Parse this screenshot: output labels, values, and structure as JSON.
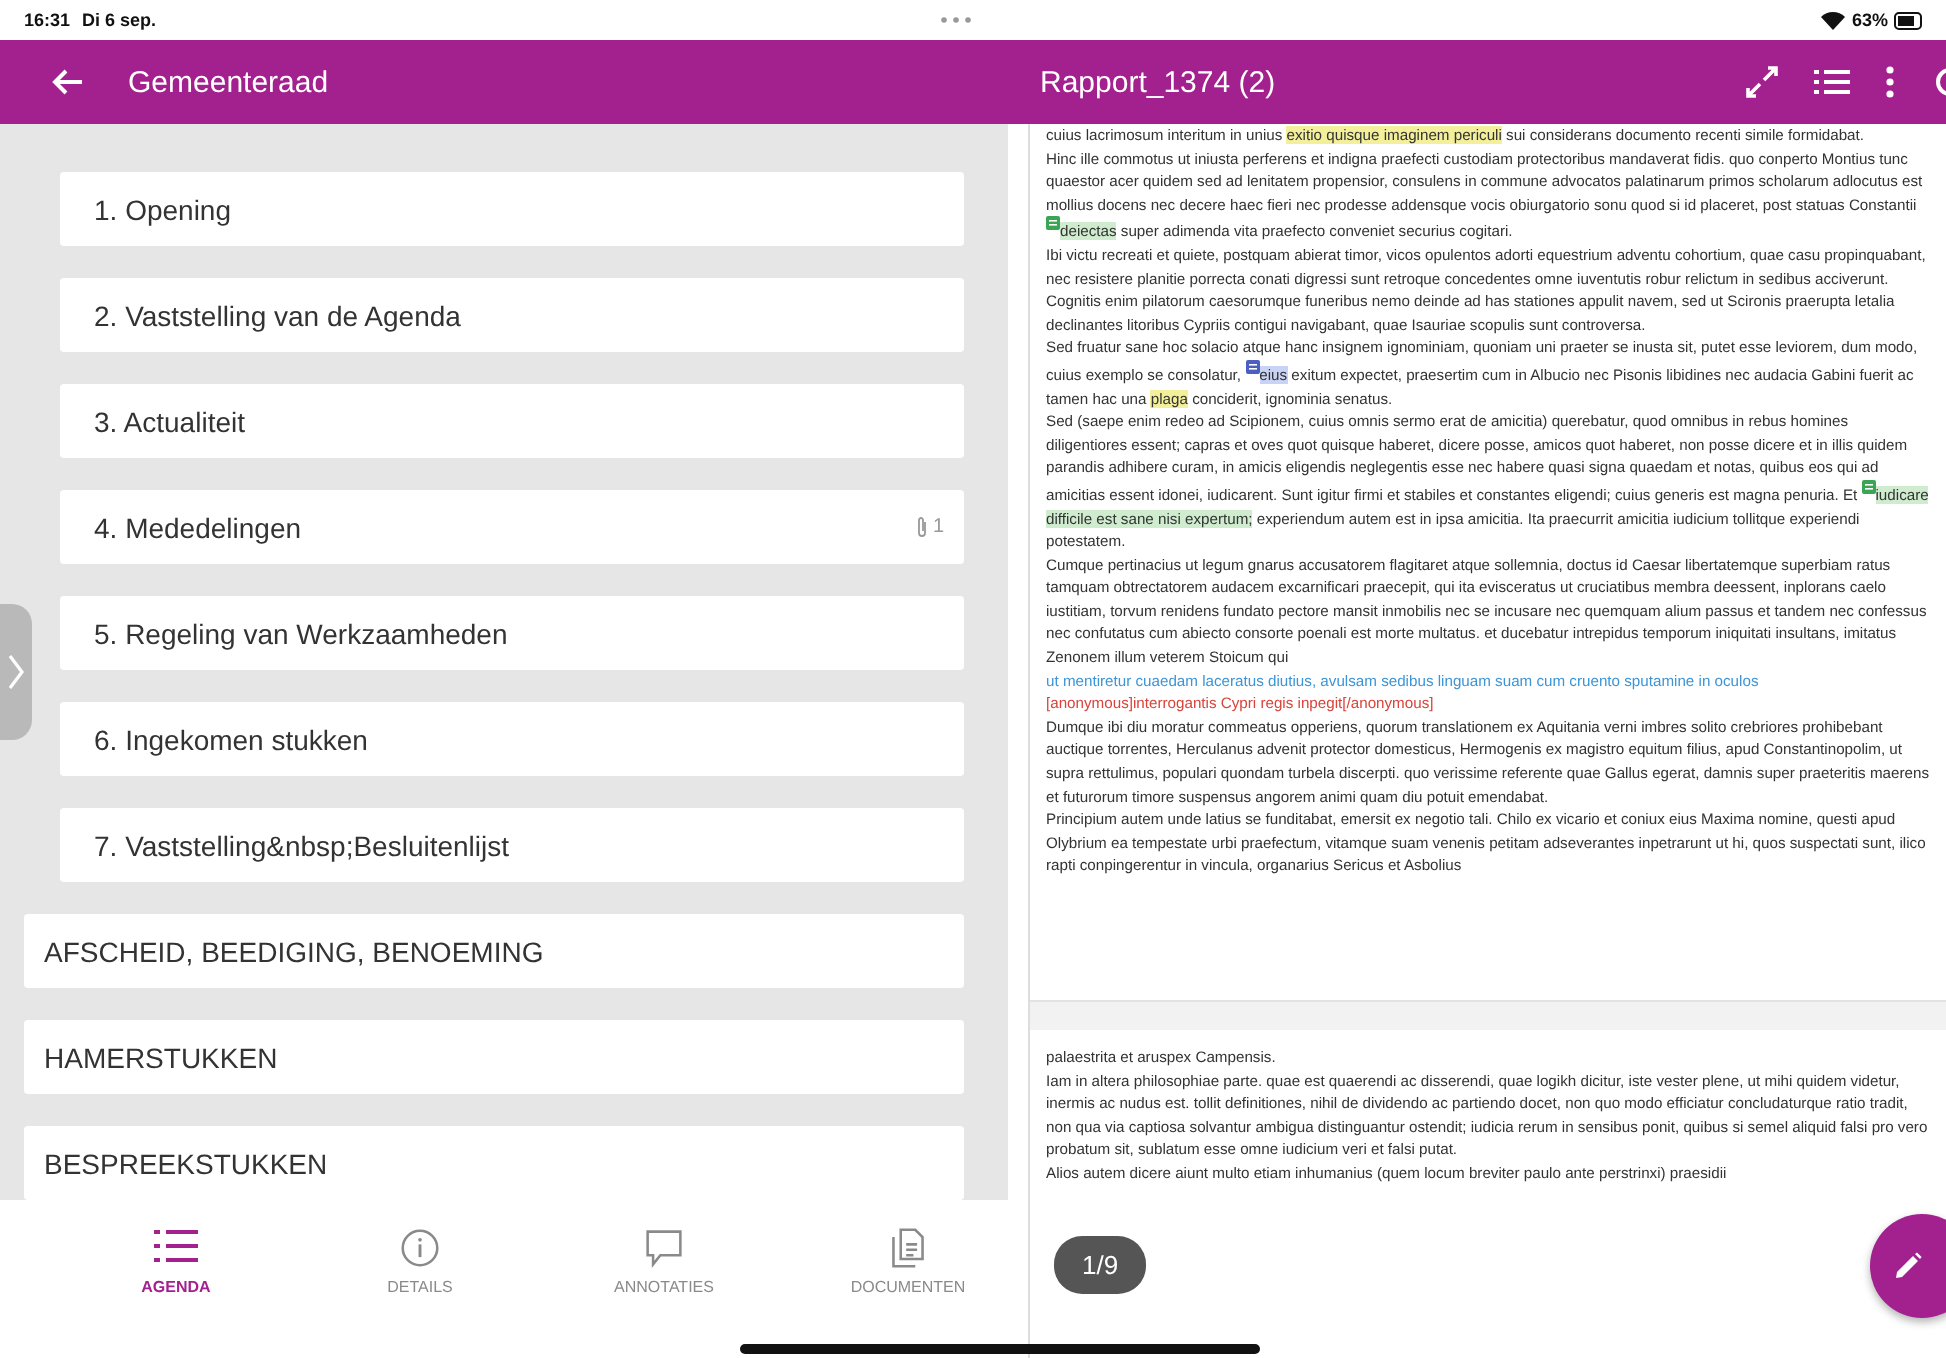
{
  "status_bar": {
    "time": "16:31",
    "date": "Di 6 sep.",
    "battery": "63%"
  },
  "header": {
    "back_title": "Gemeenteraad",
    "document_title": "Rapport_1374 (2)"
  },
  "agenda": {
    "items": [
      {
        "label": "1. Opening",
        "kind": "item"
      },
      {
        "label": "2. Vaststelling van de Agenda",
        "kind": "item"
      },
      {
        "label": "3. Actualiteit",
        "kind": "item"
      },
      {
        "label": "4. Mededelingen",
        "kind": "item",
        "attachments": "1"
      },
      {
        "label": "5. Regeling van Werkzaamheden",
        "kind": "item"
      },
      {
        "label": "6. Ingekomen stukken",
        "kind": "item"
      },
      {
        "label": "7. Vaststelling&nbsp;Besluitenlijst",
        "kind": "item"
      },
      {
        "label": "AFSCHEID, BEEDIGING, BENOEMING",
        "kind": "section"
      },
      {
        "label": "HAMERSTUKKEN",
        "kind": "section"
      },
      {
        "label": "BESPREEKSTUKKEN",
        "kind": "section"
      }
    ]
  },
  "bottom_tabs": [
    {
      "label": "AGENDA",
      "selected": true
    },
    {
      "label": "DETAILS",
      "selected": false
    },
    {
      "label": "ANNOTATIES",
      "selected": false
    },
    {
      "label": "DOCUMENTEN",
      "selected": false
    }
  ],
  "document": {
    "page_indicator": "1/9",
    "pages": [
      {
        "paragraphs": [
          {
            "segments": [
              {
                "kind": "plain",
                "text": "cuius lacrimosum interitum in unius "
              },
              {
                "kind": "highlight",
                "color": "#f3ef9a",
                "text": "exitio quisque imaginem periculi"
              },
              {
                "kind": "plain",
                "text": " sui considerans documento recenti simile formidabat."
              }
            ]
          },
          {
            "segments": [
              {
                "kind": "plain",
                "text": "Hinc ille commotus ut iniusta perferens et indigna praefecti custodiam protectoribus mandaverat fidis. quo conperto Montius tunc quaestor acer quidem sed ad lenitatem propensior, consulens in commune advocatos palatinarum primos scholarum adlocutus est mollius docens nec decere haec fieri nec prodesse addensque vocis obiurgatorio sonu quod si id placeret, post statuas Constantii "
              },
              {
                "kind": "note",
                "color": "#3aa655"
              },
              {
                "kind": "highlight",
                "color": "#cfeccf",
                "text": "deiectas"
              },
              {
                "kind": "plain",
                "text": " super adimenda vita praefecto conveniet securius cogitari."
              }
            ]
          },
          {
            "segments": [
              {
                "kind": "plain",
                "text": "Ibi victu recreati et quiete, postquam abierat timor, vicos opulentos adorti equestrium adventu cohortium, quae casu propinquabant, nec resistere planitie porrecta conati digressi sunt retroque concedentes omne iuventutis robur relictum in sedibus acciverunt."
              }
            ]
          },
          {
            "segments": [
              {
                "kind": "plain",
                "text": "Cognitis enim pilatorum caesorumque funeribus nemo deinde ad has stationes appulit navem, sed ut Scironis praerupta letalia declinantes litoribus Cypriis contigui navigabant, quae Isauriae scopulis sunt controversa."
              }
            ]
          },
          {
            "segments": [
              {
                "kind": "plain",
                "text": "Sed fruatur sane hoc solacio atque hanc insignem ignominiam, quoniam uni praeter se inusta sit, putet esse leviorem, dum modo, cuius exemplo se consolatur, "
              },
              {
                "kind": "note",
                "color": "#4a5fc1"
              },
              {
                "kind": "highlight",
                "color": "#c9d3f5",
                "text": "eius"
              },
              {
                "kind": "plain",
                "text": " exitum expectet, praesertim cum in Albucio nec Pisonis libidines nec audacia Gabini fuerit ac tamen hac una "
              },
              {
                "kind": "highlight",
                "color": "#f3ef9a",
                "text": "plaga"
              },
              {
                "kind": "plain",
                "text": " conciderit, ignominia senatus."
              }
            ]
          },
          {
            "segments": [
              {
                "kind": "plain",
                "text": "Sed (saepe enim redeo ad Scipionem, cuius omnis sermo erat de amicitia) querebatur, quod omnibus in rebus homines diligentiores essent; capras et oves quot quisque haberet, dicere posse, amicos quot haberet, non posse dicere et in illis quidem parandis adhibere curam, in amicis eligendis neglegentis esse nec habere quasi signa quaedam et notas, quibus eos qui ad amicitias essent idonei, iudicarent. Sunt igitur firmi et stabiles et constantes eligendi; cuius generis est magna penuria. Et "
              },
              {
                "kind": "note",
                "color": "#3aa655"
              },
              {
                "kind": "highlight",
                "color": "#cfeccf",
                "text": "iudicare difficile est sane nisi expertum;"
              },
              {
                "kind": "plain",
                "text": " experiendum autem est in ipsa amicitia. Ita praecurrit amicitia iudicium tollitque experiendi potestatem."
              }
            ]
          },
          {
            "segments": [
              {
                "kind": "plain",
                "text": "Cumque pertinacius ut legum gnarus accusatorem flagitaret atque sollemnia, doctus id Caesar libertatemque superbiam ratus tamquam obtrectatorem audacem excarnificari praecepit, qui ita evisceratus ut cruciatibus membra deessent, inplorans caelo iustitiam, torvum renidens fundato pectore mansit inmobilis nec se incusare nec quemquam alium passus et tandem nec confessus nec confutatus cum abiecto consorte poenali est morte multatus. et ducebatur intrepidus temporum iniquitati insultans, imitatus Zenonem illum veterem Stoicum qui"
              }
            ]
          },
          {
            "segments": [
              {
                "kind": "colored",
                "color": "#3d95d6",
                "text": "ut mentiretur cuaedam laceratus diutius, avulsam sedibus linguam suam cum cruento sputamine in oculos"
              }
            ]
          },
          {
            "segments": [
              {
                "kind": "colored",
                "color": "#d9433a",
                "text": "[anonymous]interrogantis Cypri regis inpegit[/anonymous]"
              }
            ]
          },
          {
            "segments": [
              {
                "kind": "plain",
                "text": "Dumque ibi diu moratur commeatus opperiens, quorum translationem ex Aquitania verni imbres solito crebriores prohibebant auctique torrentes, Herculanus advenit protector domesticus, Hermogenis ex magistro equitum filius, apud Constantinopolim, ut supra rettulimus, populari quondam turbela discerpti. quo verissime referente quae Gallus egerat, damnis super praeteritis maerens et futurorum timore suspensus angorem animi quam diu potuit emendabat."
              }
            ]
          },
          {
            "segments": [
              {
                "kind": "plain",
                "text": "Principium autem unde latius se funditabat, emersit ex negotio tali. Chilo ex vicario et coniux eius Maxima nomine, questi apud Olybrium ea tempestate urbi praefectum, vitamque suam venenis petitam adseverantes inpetrarunt ut hi, quos suspectati sunt, ilico rapti conpingerentur in vincula, organarius Sericus et Asbolius"
              }
            ]
          }
        ]
      },
      {
        "paragraphs": [
          {
            "segments": [
              {
                "kind": "plain",
                "text": "palaestrita et aruspex Campensis."
              }
            ]
          },
          {
            "segments": [
              {
                "kind": "plain",
                "text": "Iam in altera philosophiae parte. quae est quaerendi ac disserendi, quae logikh dicitur, iste vester plene, ut mihi quidem videtur, inermis ac nudus est. tollit definitiones, nihil de dividendo ac partiendo docet, non quo modo efficiatur concludaturque ratio tradit, non qua via captiosa solvantur ambigua distinguantur ostendit; iudicia rerum in sensibus ponit, quibus si semel aliquid falsi pro vero probatum sit, sublatum esse omne iudicium veri et falsi putat."
              }
            ]
          },
          {
            "segments": [
              {
                "kind": "plain",
                "text": "Alios autem dicere aiunt multo etiam inhumanius (quem locum breviter paulo ante perstrinxi) praesidii"
              }
            ]
          }
        ]
      }
    ]
  }
}
